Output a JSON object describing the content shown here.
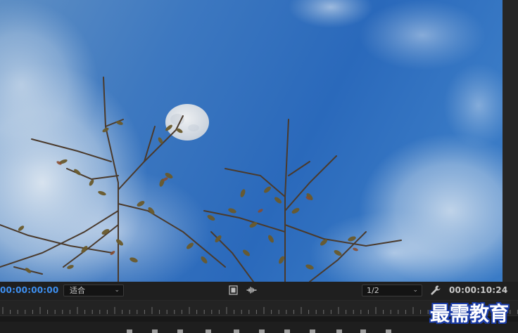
{
  "program_monitor": {
    "current_timecode": "00:00:00:00",
    "zoom_select": {
      "selected": "适合"
    },
    "resolution_select": {
      "selected": "1/2"
    },
    "duration_timecode": "00:00:10:24",
    "icons": {
      "export_frame": "film-frame-icon",
      "audio_scrub": "audio-waveform-icon",
      "settings": "wrench-icon",
      "dropdown": "chevron-down-icon"
    },
    "colors": {
      "timecode_accent": "#3d8ff0",
      "panel_bg": "#1f1f1f",
      "watermark_outline": "#1b3ca8"
    }
  },
  "watermark": {
    "text": "最需教育"
  }
}
